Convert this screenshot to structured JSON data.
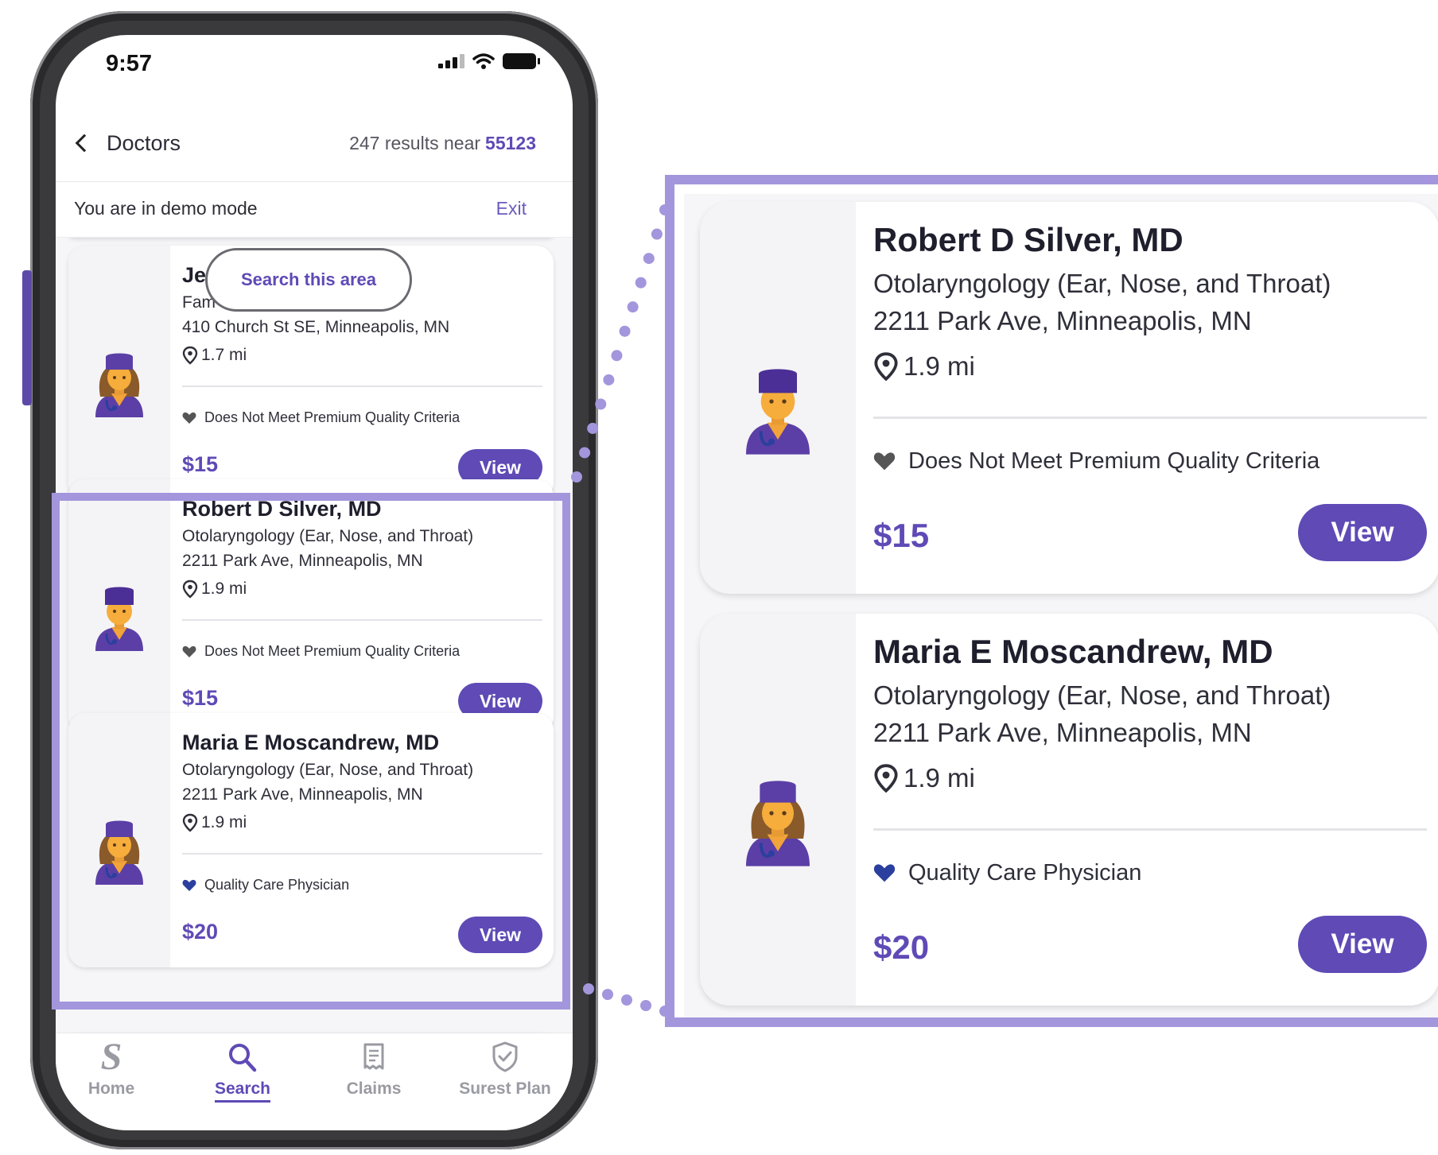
{
  "status_bar": {
    "time": "9:57"
  },
  "header": {
    "title": "Doctors",
    "results_text": "247 results near",
    "zip": "55123"
  },
  "demo_bar": {
    "text": "You are in demo mode",
    "exit_label": "Exit"
  },
  "search_area_label": "Search this area",
  "doctors": [
    {
      "name": "Je                    MD",
      "specialty": "Fam",
      "address": "410 Church St SE, Minneapolis, MN",
      "distance": "1.7 mi",
      "quality": "Does Not Meet Premium Quality Criteria",
      "quality_heart_color": "#555555",
      "price": "$15",
      "view_label": "View",
      "avatar": "female-doctor"
    },
    {
      "name": "Robert D Silver, MD",
      "specialty": "Otolaryngology (Ear, Nose, and Throat)",
      "address": "2211 Park Ave, Minneapolis, MN",
      "distance": "1.9 mi",
      "quality": "Does Not Meet Premium Quality Criteria",
      "quality_heart_color": "#555555",
      "price": "$15",
      "view_label": "View",
      "avatar": "male-doctor"
    },
    {
      "name": "Maria E Moscandrew, MD",
      "specialty": "Otolaryngology (Ear, Nose, and Throat)",
      "address": "2211 Park Ave, Minneapolis, MN",
      "distance": "1.9 mi",
      "quality": "Quality Care Physician",
      "quality_heart_color": "#2b3f9e",
      "price": "$20",
      "view_label": "View",
      "avatar": "female-doctor"
    }
  ],
  "bottom_nav": [
    {
      "label": "Home",
      "icon": "surest-s-logo-icon",
      "active": false
    },
    {
      "label": "Search",
      "icon": "search-icon",
      "active": true
    },
    {
      "label": "Claims",
      "icon": "receipt-icon",
      "active": false
    },
    {
      "label": "Surest Plan",
      "icon": "shield-check-icon",
      "active": false
    }
  ],
  "colors": {
    "accent": "#5f4ab6",
    "highlight": "#a396dc"
  }
}
